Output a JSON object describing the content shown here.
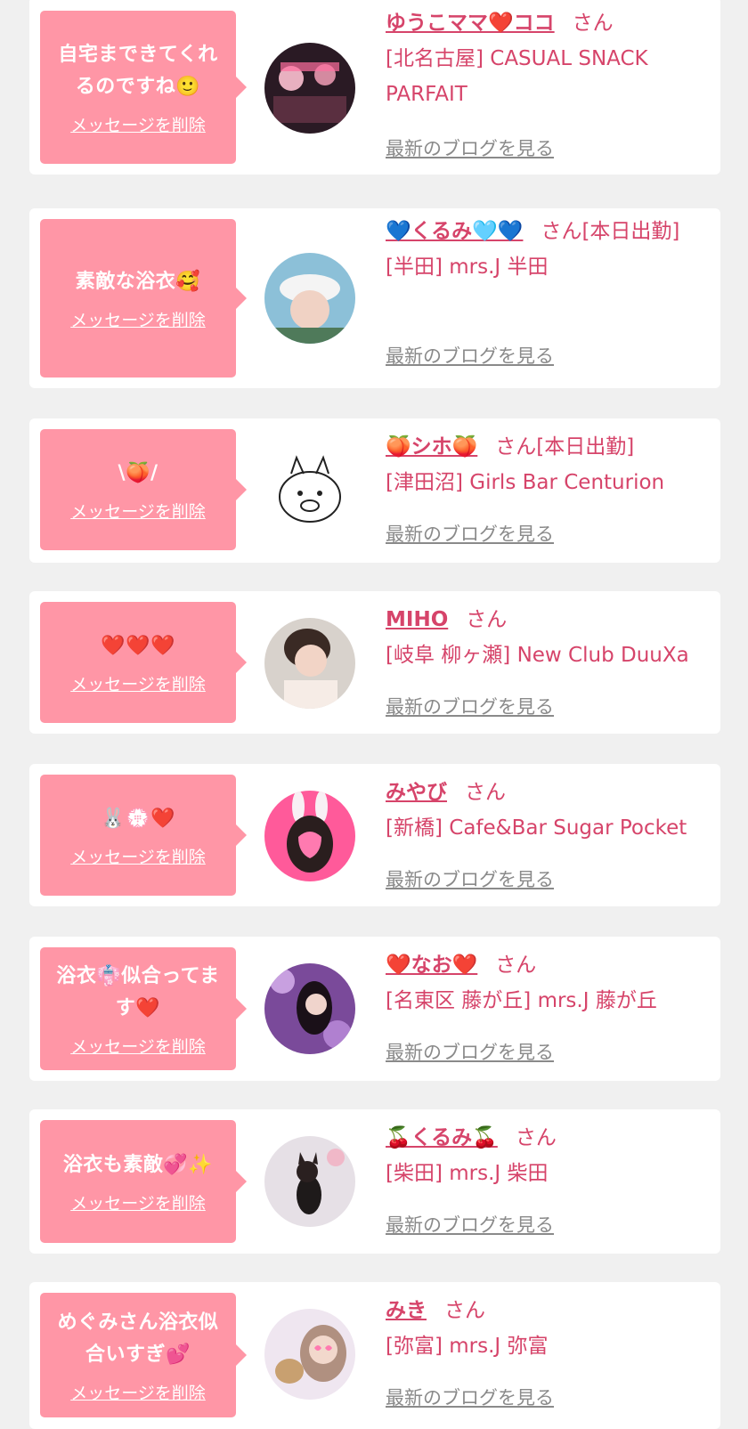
{
  "common": {
    "delete_label": "メッセージを削除",
    "blog_label": "最新のブログを見る",
    "san_label": "さん"
  },
  "colors": {
    "page_bg": "#f0f0f0",
    "bubble_bg": "#ff96a6",
    "accent_text": "#d6446a",
    "link_gray": "#8a8a8a"
  },
  "items": [
    {
      "message": "自宅まできてくれるのですね🙂",
      "name": "ゆうこママ❤️ココ",
      "san": "さん",
      "shop": "[北名古屋] CASUAL SNACK PARFAIT"
    },
    {
      "message": "素敵な浴衣🥰",
      "name": "💙くるみ🩵💙",
      "san": "さん[本日出勤]",
      "shop": "[半田] mrs.J 半田"
    },
    {
      "message": "\\🍑/",
      "name": "🍑シホ🍑",
      "san": "さん[本日出勤]",
      "shop": "[津田沼] Girls Bar Centurion"
    },
    {
      "message": "❤️❤️❤️",
      "name": "MIHO",
      "san": "さん",
      "shop": "[岐阜 柳ヶ瀬] New Club DuuXa"
    },
    {
      "message": "🐰💮❤️",
      "name": "みやび",
      "san": "さん",
      "shop": "[新橋] Cafe&Bar Sugar Pocket"
    },
    {
      "message": "浴衣👘似合ってます❤️",
      "name": "❤️なお❤️",
      "san": "さん",
      "shop": "[名東区 藤が丘] mrs.J 藤が丘"
    },
    {
      "message": "浴衣も素敵💞✨",
      "name": "🍒くるみ🍒",
      "san": "さん",
      "shop": "[柴田] mrs.J 柴田"
    },
    {
      "message": "めぐみさん浴衣似合いすぎ💕",
      "name": "みき",
      "san": "さん",
      "shop": "[弥富] mrs.J 弥富"
    }
  ]
}
